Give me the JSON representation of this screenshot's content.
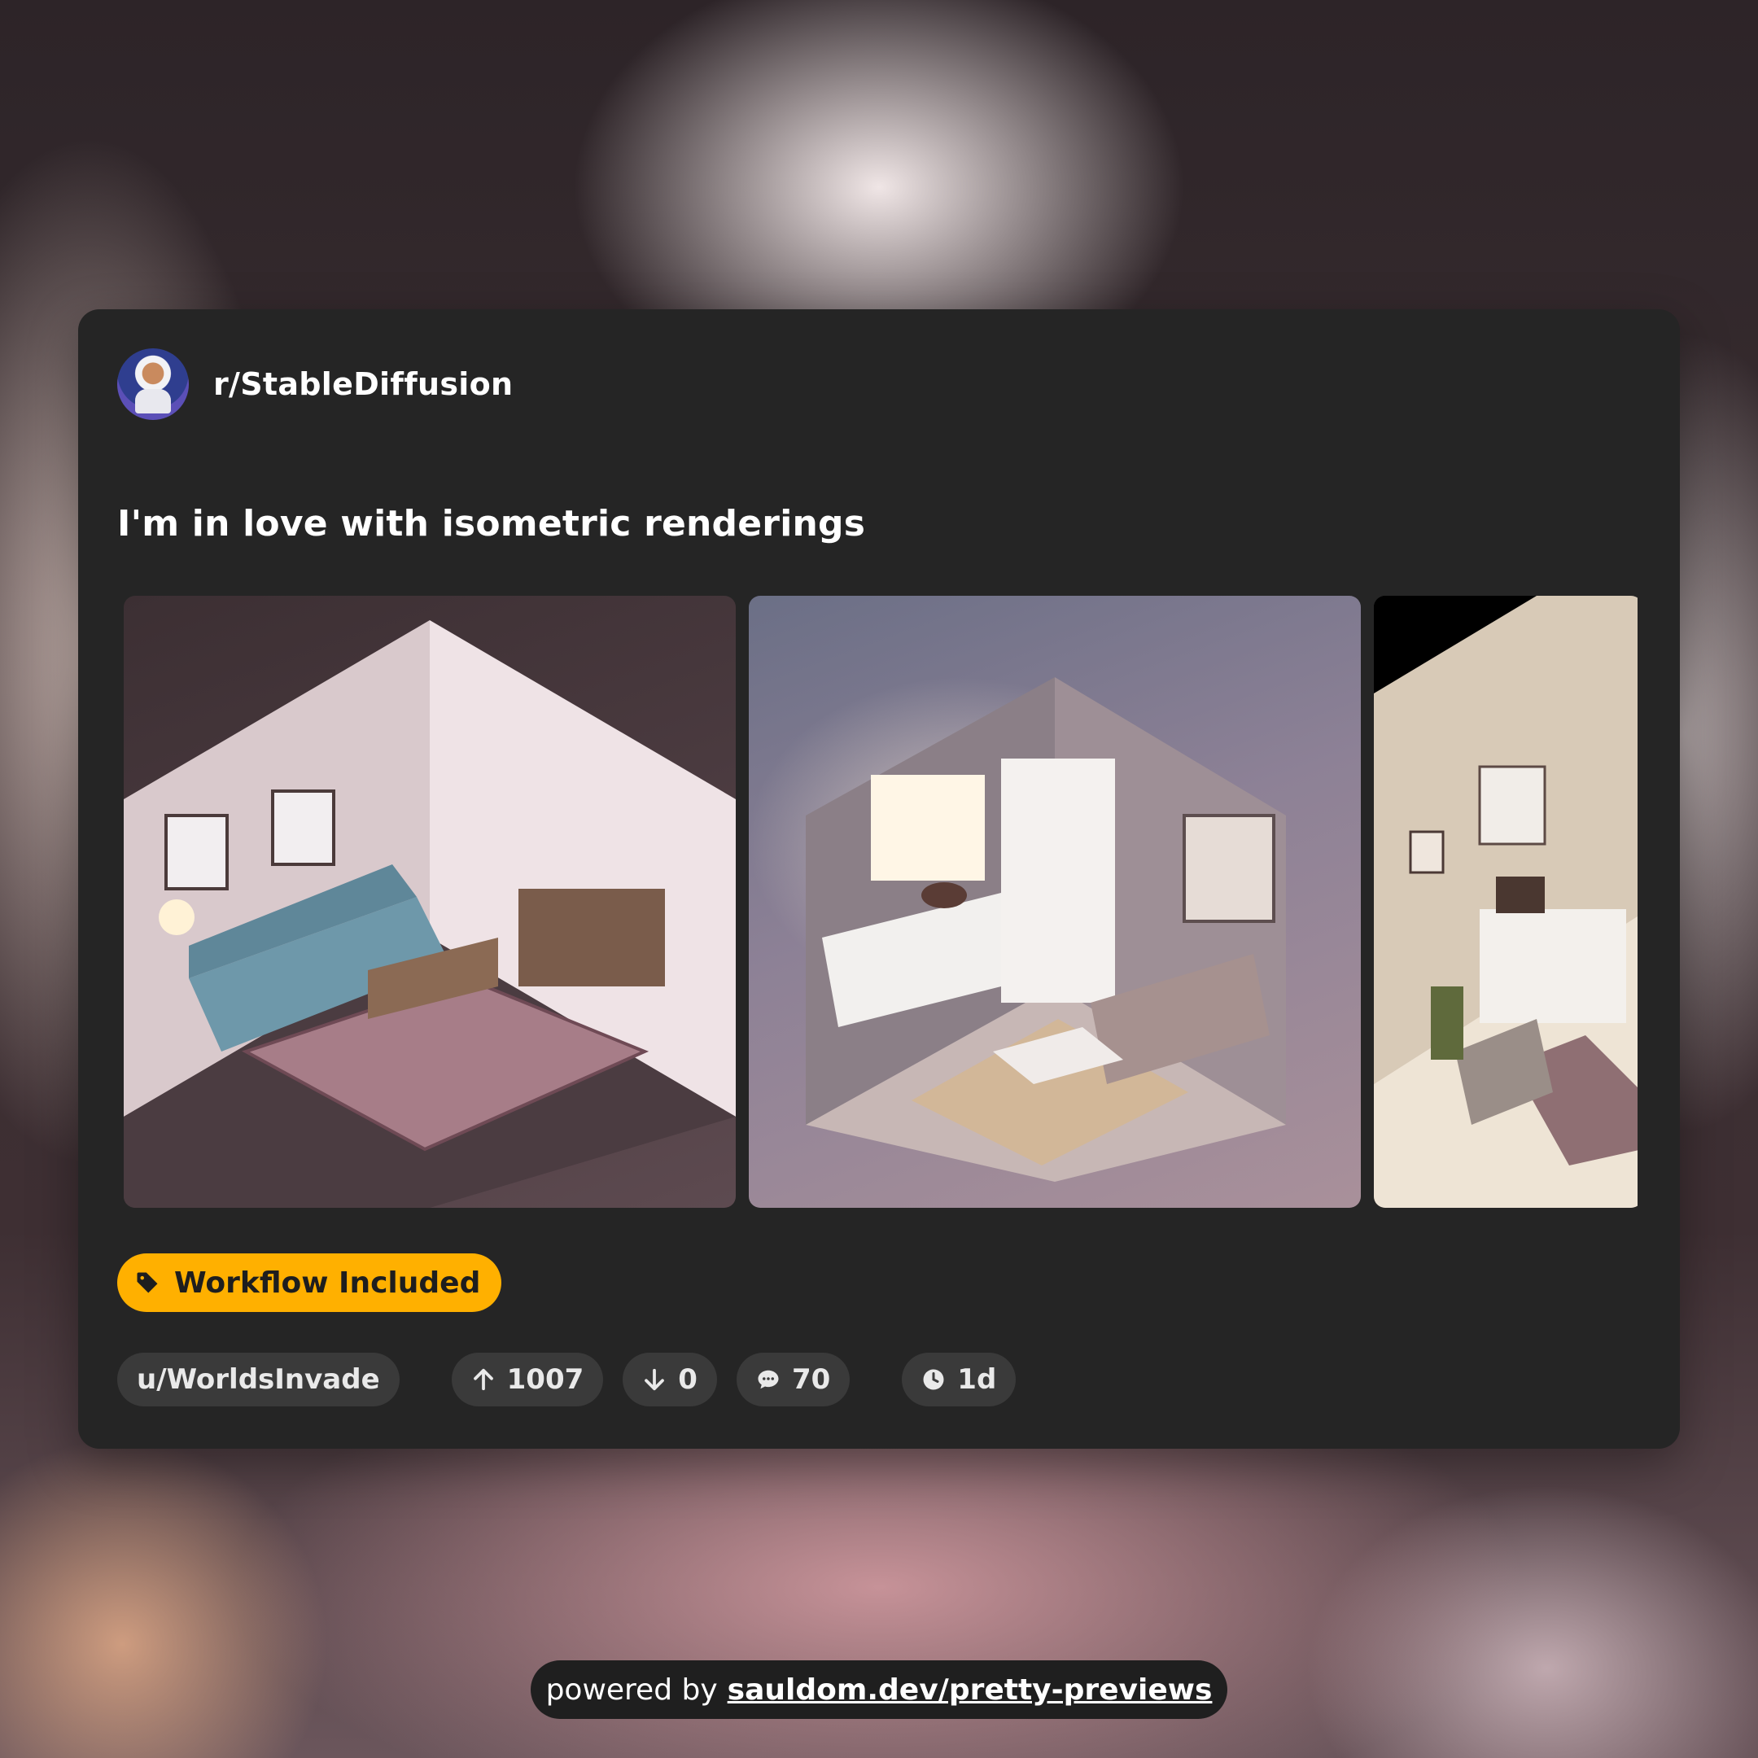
{
  "post": {
    "subreddit": "r/StableDiffusion",
    "title": "I'm in love with isometric renderings",
    "flair": "Workflow Included",
    "author": "u/WorldsInvade",
    "upvotes": "1007",
    "downvotes": "0",
    "comments": "70",
    "age": "1d"
  },
  "gallery": {
    "images": [
      {
        "alt": "isometric living room with blue sofa"
      },
      {
        "alt": "isometric kitchen and living room"
      },
      {
        "alt": "isometric kitchen with armchair"
      }
    ]
  },
  "footer": {
    "prefix": "powered by",
    "link": "sauldom.dev/pretty-previews"
  },
  "icons": {
    "flair": "tag-icon",
    "upvote": "arrow-up-icon",
    "downvote": "arrow-down-icon",
    "comments": "chat-bubble-icon",
    "age": "clock-icon"
  },
  "colors": {
    "card": "#252525",
    "flair": "#ffb000",
    "pill": "#3a3a3a"
  }
}
